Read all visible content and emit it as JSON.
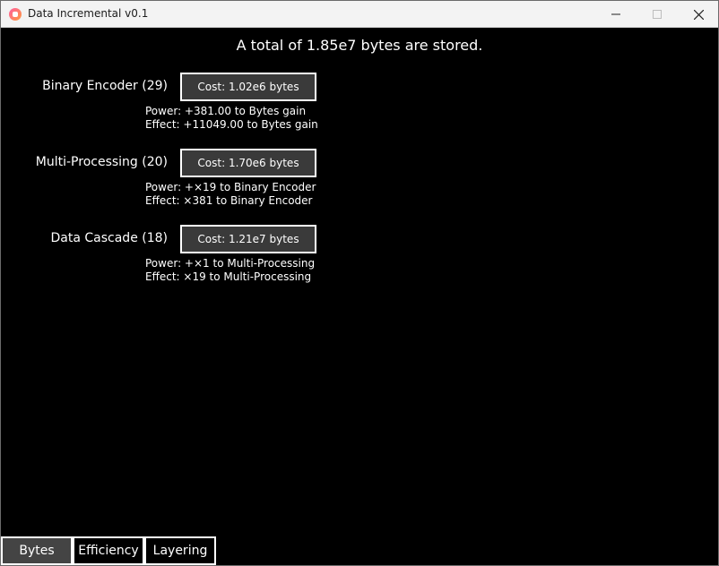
{
  "window": {
    "title": "Data Incremental v0.1"
  },
  "headline": "A total of 1.85e7 bytes are stored.",
  "upgrades": [
    {
      "label": "Binary Encoder (29)",
      "cost": "Cost: 1.02e6 bytes",
      "power": "Power: +381.00 to Bytes gain",
      "effect": "Effect: +11049.00 to Bytes gain"
    },
    {
      "label": "Multi-Processing (20)",
      "cost": "Cost: 1.70e6 bytes",
      "power": "Power: +×19 to Binary Encoder",
      "effect": "Effect: ×381 to Binary Encoder"
    },
    {
      "label": "Data Cascade (18)",
      "cost": "Cost: 1.21e7 bytes",
      "power": "Power: +×1 to Multi-Processing",
      "effect": "Effect: ×19 to Multi-Processing"
    }
  ],
  "tabs": [
    {
      "label": "Bytes",
      "active": true
    },
    {
      "label": "Efficiency",
      "active": false
    },
    {
      "label": "Layering",
      "active": false
    }
  ],
  "colors": {
    "background": "#000000",
    "button_bg": "#3a3a3a",
    "active_tab_bg": "#444444",
    "text": "#ffffff"
  }
}
